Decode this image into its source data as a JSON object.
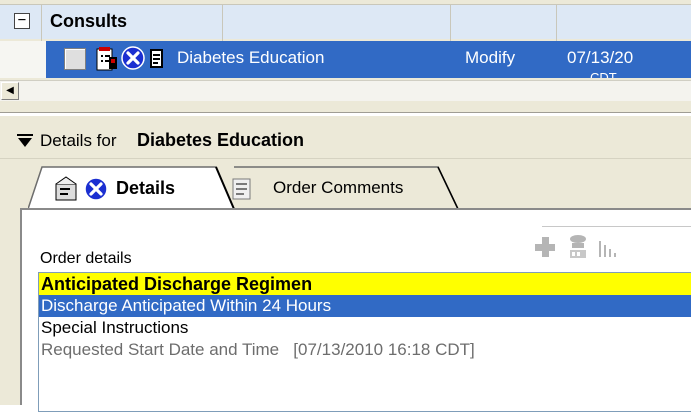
{
  "orders_grid": {
    "group": {
      "label": "Consults",
      "collapse_glyph": "⊟"
    },
    "row": {
      "name": "Diabetes Education",
      "action": "Modify",
      "date": "07/13/20",
      "timezone_fragment": "CDT",
      "icons": [
        "order-sheet-icon",
        "cancel-icon",
        "document-icon"
      ]
    },
    "scroll_left_glyph": "◀"
  },
  "details_panel": {
    "header_prefix": "Details for",
    "header_name": "Diabetes Education",
    "tabs": [
      {
        "label": "Details",
        "active": true
      },
      {
        "label": "Order Comments",
        "active": false
      }
    ],
    "order_details_label": "Order details",
    "items": [
      {
        "text": "Anticipated Discharge Regimen",
        "style": "header"
      },
      {
        "text": "Discharge Anticipated Within 24 Hours",
        "style": "selected"
      },
      {
        "text": "Special Instructions",
        "style": "normal"
      },
      {
        "text": "Requested Start Date and Time   [07/13/2010 16:18 CDT]",
        "style": "disabled"
      }
    ]
  },
  "colors": {
    "selection_blue": "#316ac5",
    "highlight_yellow": "#ffff00",
    "chrome_beige": "#ece9d8",
    "group_row": "#dde8f5"
  }
}
